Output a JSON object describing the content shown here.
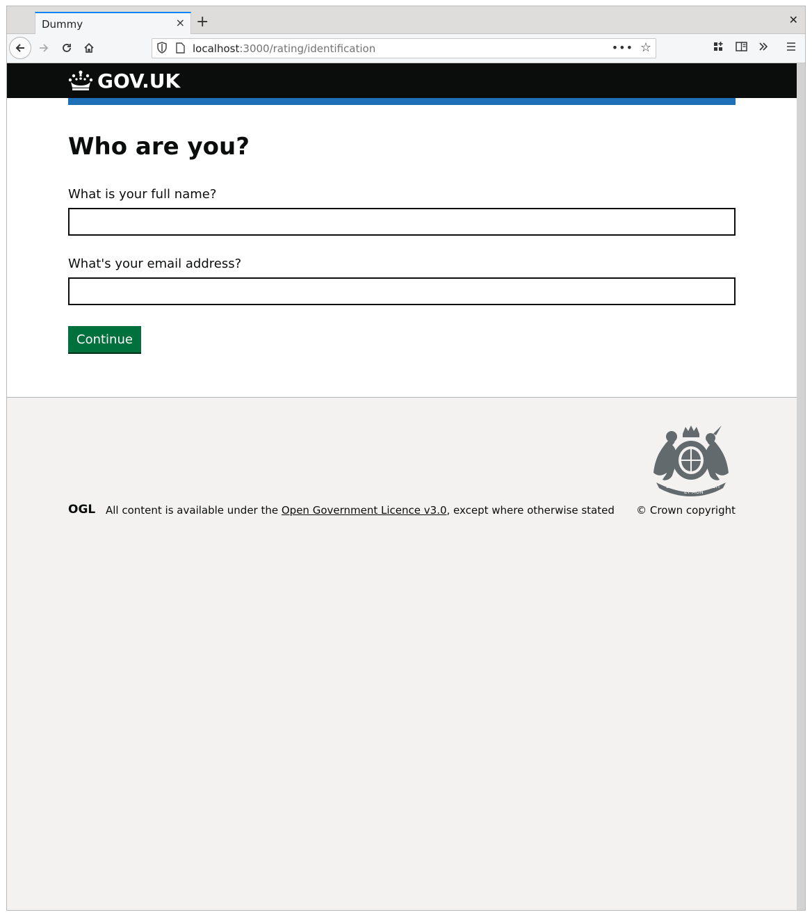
{
  "browser": {
    "tab_title": "Dummy",
    "tab_close": "×",
    "new_tab": "+",
    "window_close": "✕",
    "url_host": "localhost",
    "url_path": ":3000/rating/identification",
    "url_more": "•••",
    "icons": [
      "back-arrow-icon",
      "forward-arrow-icon",
      "reload-icon",
      "home-icon",
      "shield-icon",
      "page-icon",
      "star-icon",
      "library-icon",
      "reader-view-icon",
      "overflow-icon",
      "hamburger-menu-icon"
    ]
  },
  "header": {
    "logo_text": "GOV.UK",
    "colors": {
      "header_bg": "#0b0c0c",
      "blue_bar": "#1d70b8"
    }
  },
  "main": {
    "title": "Who are you?",
    "fields": [
      {
        "label": "What is your full name?",
        "value": ""
      },
      {
        "label": "What's your email address?",
        "value": ""
      }
    ],
    "continue_label": "Continue",
    "colors": {
      "button": "#00703c"
    }
  },
  "footer": {
    "ogl_label": "OGL",
    "licence_prefix": "All content is available under the ",
    "licence_link": "Open Government Licence v3.0",
    "licence_suffix": ", except where otherwise stated",
    "copyright": "© Crown copyright",
    "crest_motto_left": "DIEU",
    "crest_motto_mid": "ET MON",
    "crest_motto_right": "DROIT",
    "colors": {
      "footer_bg": "#f3f2f1"
    }
  }
}
